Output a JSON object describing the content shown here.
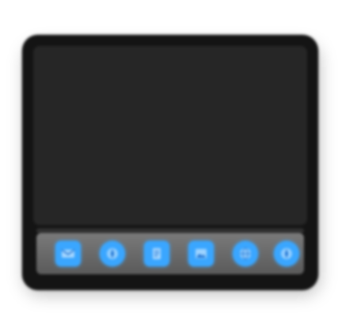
{
  "icon": {
    "name": "dock-preferences-icon",
    "colors": {
      "body": "#141414",
      "screen": "#262626",
      "dock": "#6a6a6a",
      "accent": "#3aa6ff"
    }
  },
  "dock": {
    "items": [
      {
        "icon": "mail-icon",
        "color": "#3aa6ff",
        "shape": "square"
      },
      {
        "icon": "compass-icon",
        "color": "#3aa6ff",
        "shape": "circle"
      },
      {
        "icon": "document-icon",
        "color": "#3aa6ff",
        "shape": "square"
      },
      {
        "icon": "photo-icon",
        "color": "#3aa6ff",
        "shape": "square"
      },
      {
        "icon": "globe-icon",
        "color": "#3aa6ff",
        "shape": "circle"
      },
      {
        "icon": "compass-icon",
        "color": "#3aa6ff",
        "shape": "circle"
      }
    ]
  }
}
